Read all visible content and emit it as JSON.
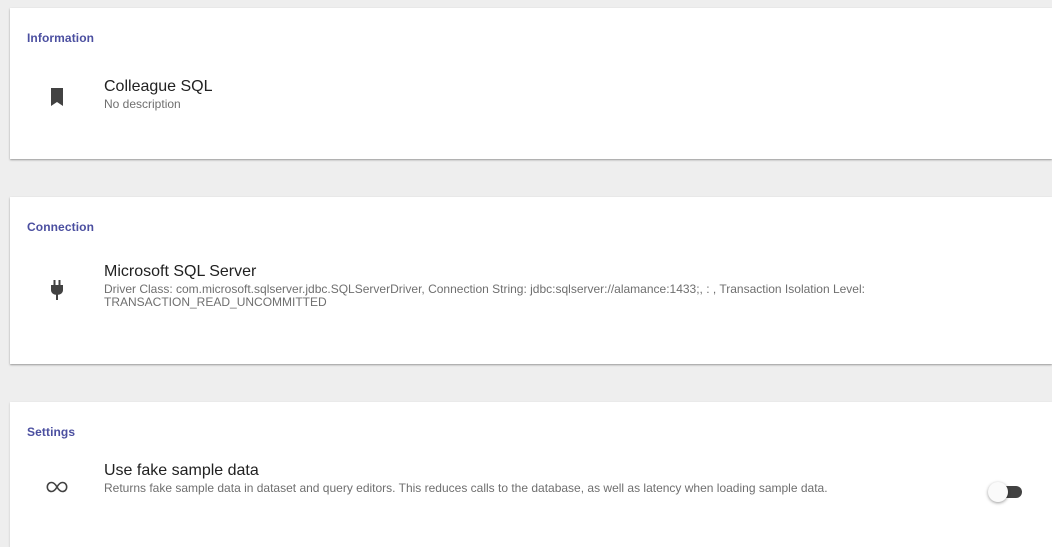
{
  "information": {
    "section_title": "Information",
    "icon": "bookmark-icon",
    "name": "Colleague SQL",
    "description": "No description"
  },
  "connection": {
    "section_title": "Connection",
    "icon": "plug-icon",
    "driver_name": "Microsoft SQL Server",
    "details": "Driver Class: com.microsoft.sqlserver.jdbc.SQLServerDriver, Connection String: jdbc:sqlserver://alamance:1433;, : , Transaction Isolation Level: TRANSACTION_READ_UNCOMMITTED"
  },
  "settings": {
    "section_title": "Settings",
    "fake_data": {
      "icon": "infinity-icon",
      "label": "Use fake sample data",
      "description": "Returns fake sample data in dataset and query editors. This reduces calls to the database, as well as latency when loading sample data.",
      "enabled": false
    }
  },
  "colors": {
    "section_title": "#4b4fa0",
    "background": "#eeeeee",
    "card": "#ffffff",
    "toggle_track": "#424242",
    "toggle_thumb": "#fafafa"
  }
}
